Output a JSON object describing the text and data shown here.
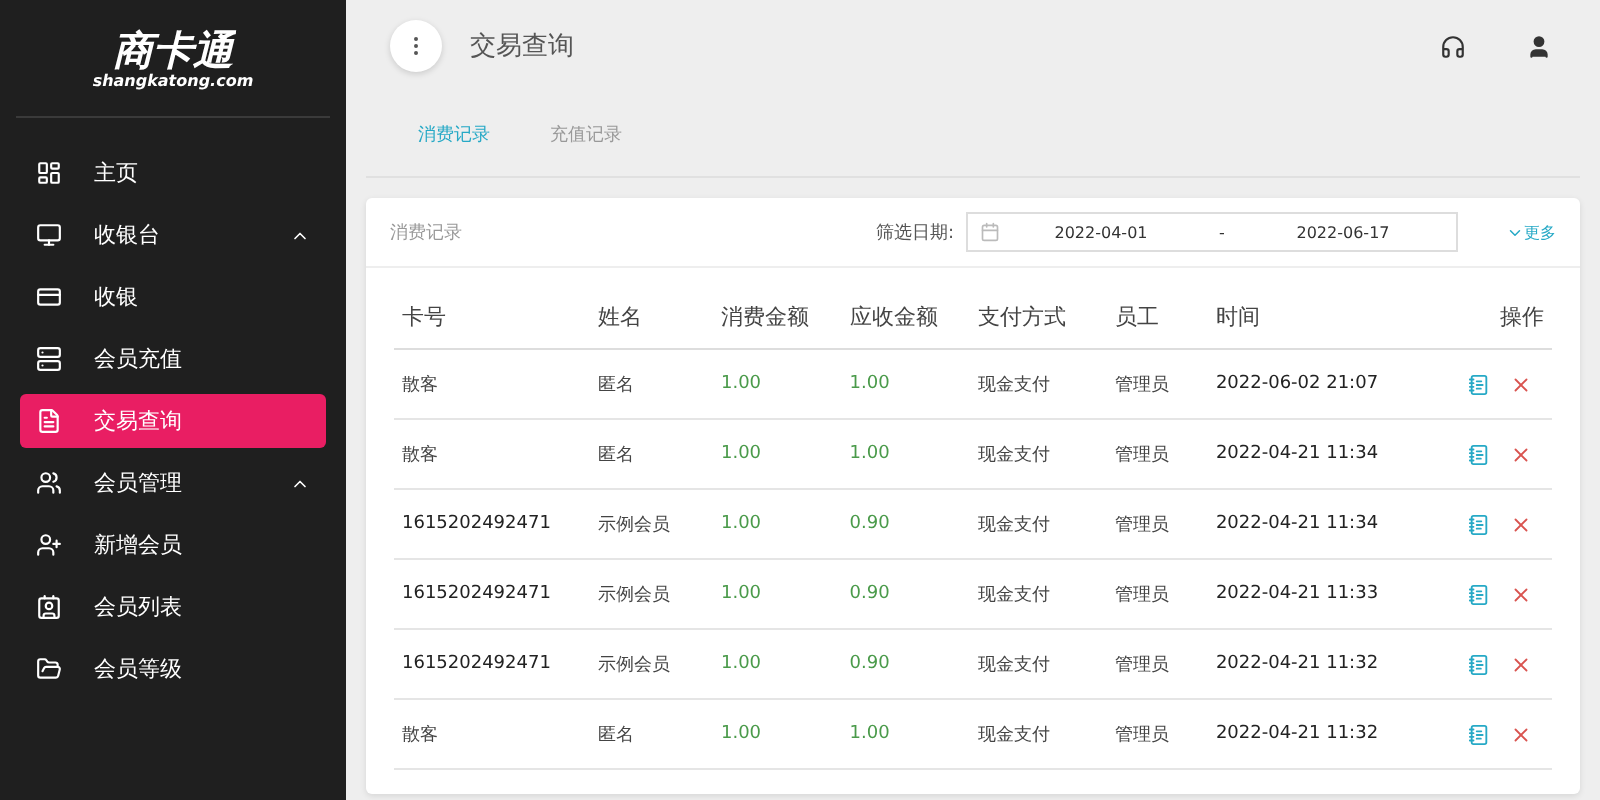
{
  "logo": {
    "name": "商卡通",
    "domain": "shangkatong.com"
  },
  "sidebar": {
    "items": [
      {
        "label": "主页",
        "selected": false
      },
      {
        "label": "收银台",
        "expanded": true,
        "selected": false,
        "children": [
          {
            "label": "收银",
            "selected": false
          },
          {
            "label": "会员充值",
            "selected": false
          },
          {
            "label": "交易查询",
            "selected": true
          }
        ]
      },
      {
        "label": "会员管理",
        "expanded": true,
        "selected": false,
        "children": [
          {
            "label": "新增会员",
            "selected": false
          },
          {
            "label": "会员列表",
            "selected": false
          },
          {
            "label": "会员等级",
            "selected": false
          }
        ]
      }
    ]
  },
  "header": {
    "title": "交易查询"
  },
  "tabs": [
    {
      "label": "消费记录",
      "selected": true
    },
    {
      "label": "充值记录",
      "selected": false
    }
  ],
  "card": {
    "title": "消费记录",
    "filter_label": "筛选日期:",
    "date_from": "2022-04-01",
    "date_sep": "-",
    "date_to": "2022-06-17",
    "more": "更多"
  },
  "table": {
    "columns": [
      "卡号",
      "姓名",
      "消费金额",
      "应收金额",
      "支付方式",
      "员工",
      "时间",
      "操作"
    ],
    "rows": [
      [
        "散客",
        "匿名",
        "1.00",
        "1.00",
        "现金支付",
        "管理员",
        "2022-06-02 21:07"
      ],
      [
        "散客",
        "匿名",
        "1.00",
        "1.00",
        "现金支付",
        "管理员",
        "2022-04-21 11:34"
      ],
      [
        "1615202492471",
        "示例会员",
        "1.00",
        "0.90",
        "现金支付",
        "管理员",
        "2022-04-21 11:34"
      ],
      [
        "1615202492471",
        "示例会员",
        "1.00",
        "0.90",
        "现金支付",
        "管理员",
        "2022-04-21 11:33"
      ],
      [
        "1615202492471",
        "示例会员",
        "1.00",
        "0.90",
        "现金支付",
        "管理员",
        "2022-04-21 11:32"
      ],
      [
        "散客",
        "匿名",
        "1.00",
        "1.00",
        "现金支付",
        "管理员",
        "2022-04-21 11:32"
      ]
    ]
  }
}
